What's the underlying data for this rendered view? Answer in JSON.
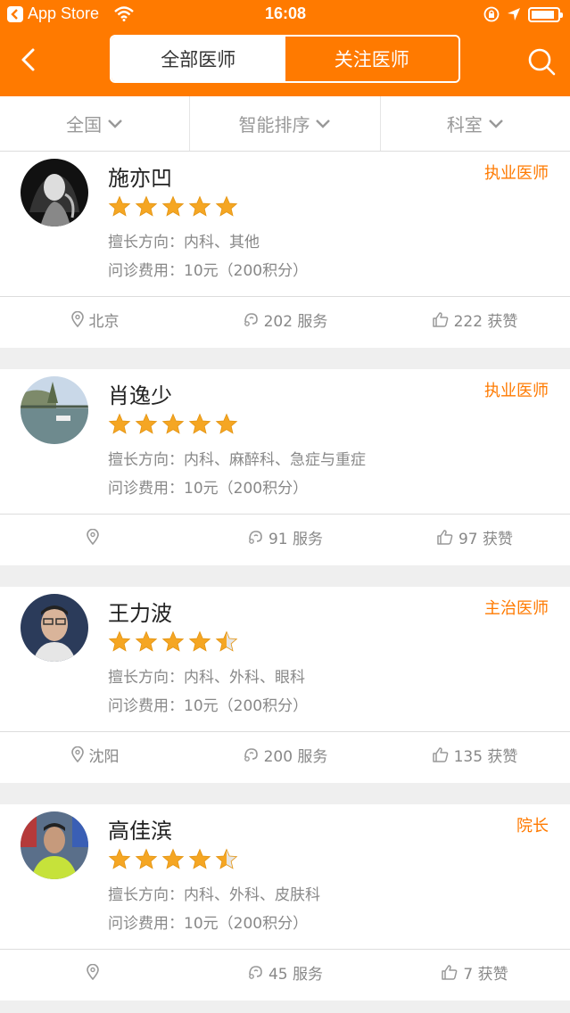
{
  "status_bar": {
    "app_label": "App Store",
    "time": "16:08",
    "battery_level": 0.9
  },
  "nav": {
    "tabs": [
      {
        "label": "全部医师",
        "active": true
      },
      {
        "label": "关注医师",
        "active": false
      }
    ]
  },
  "filters": [
    {
      "label": "全国"
    },
    {
      "label": "智能排序"
    },
    {
      "label": "科室"
    }
  ],
  "colors": {
    "accent": "#ff7a00",
    "star": "#f5a623",
    "text_muted": "#888888",
    "background": "#efefef"
  },
  "doctors": [
    {
      "name": "施亦凹",
      "title": "执业医师",
      "rating": 5,
      "skill": "擅长方向：内科、其他",
      "fee": "问诊费用：10元（200积分）",
      "location": "北京",
      "services": "202 服务",
      "likes": "222 获赞"
    },
    {
      "name": "肖逸少",
      "title": "执业医师",
      "rating": 5,
      "skill": "擅长方向：内科、麻醉科、急症与重症",
      "fee": "问诊费用：10元（200积分）",
      "location": "",
      "services": "91 服务",
      "likes": "97 获赞"
    },
    {
      "name": "王力波",
      "title": "主治医师",
      "rating": 4.5,
      "skill": "擅长方向：内科、外科、眼科",
      "fee": "问诊费用：10元（200积分）",
      "location": "沈阳",
      "services": "200 服务",
      "likes": "135 获赞"
    },
    {
      "name": "高佳滨",
      "title": "院长",
      "rating": 4.5,
      "skill": "擅长方向：内科、外科、皮肤科",
      "fee": "问诊费用：10元（200积分）",
      "location": "",
      "services": "45 服务",
      "likes": "7 获赞"
    }
  ]
}
